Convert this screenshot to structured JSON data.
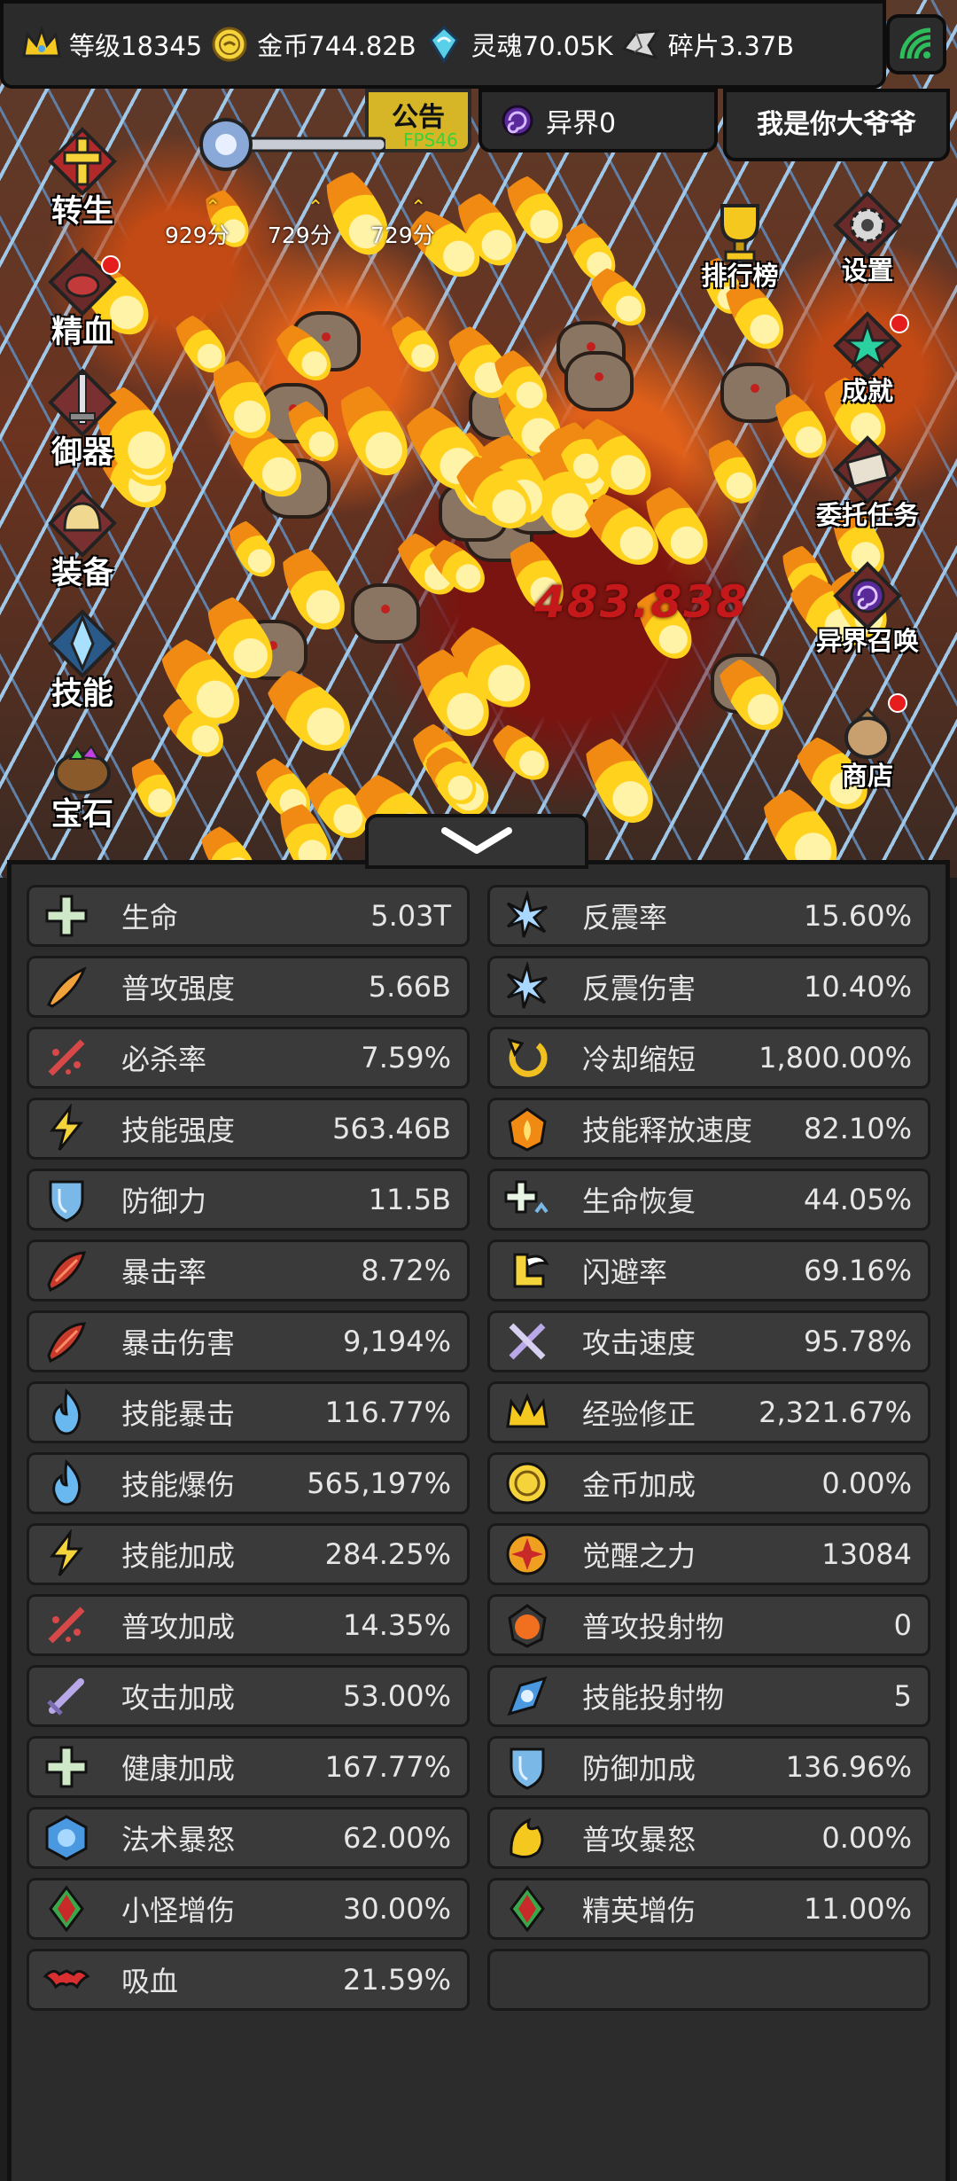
{
  "top_bar": {
    "level": "等级18345",
    "gold": "金币744.82B",
    "souls": "灵魂70.05K",
    "fragments": "碎片3.37B"
  },
  "notice_label": "公告",
  "fps_label": "FPS46",
  "otherworld_label": "异界0",
  "player_name": "我是你大爷爷",
  "scores": [
    "929分",
    "729分",
    "729分"
  ],
  "damage_number": "483.838",
  "left_menu": [
    "转生",
    "精血",
    "御器",
    "装备",
    "技能",
    "宝石"
  ],
  "right_menu": [
    "排行榜",
    "设置",
    "成就",
    "委托任务",
    "异界召唤",
    "商店"
  ],
  "stats": [
    {
      "name": "生命",
      "value": "5.03T",
      "icon": "health-plus-icon",
      "color": "#cfe9c8"
    },
    {
      "name": "反震率",
      "value": "15.60%",
      "icon": "ice-shard-icon",
      "color": "#a8d8ff"
    },
    {
      "name": "普攻强度",
      "value": "5.66B",
      "icon": "feather-strike-icon",
      "color": "#f2a23a"
    },
    {
      "name": "反震伤害",
      "value": "10.40%",
      "icon": "ice-shard-icon",
      "color": "#a8d8ff"
    },
    {
      "name": "必杀率",
      "value": "7.59%",
      "icon": "slash-icon",
      "color": "#d84848"
    },
    {
      "name": "冷却缩短",
      "value": "1,800.00%",
      "icon": "cooldown-arrow-icon",
      "color": "#f0c020"
    },
    {
      "name": "技能强度",
      "value": "563.46B",
      "icon": "lightning-icon",
      "color": "#f5d33a"
    },
    {
      "name": "技能释放速度",
      "value": "82.10%",
      "icon": "flame-badge-icon",
      "color": "#f08a12"
    },
    {
      "name": "防御力",
      "value": "11.5B",
      "icon": "shield-icon",
      "color": "#7ab8e8"
    },
    {
      "name": "生命恢复",
      "value": "44.05%",
      "icon": "regen-plus-icon",
      "color": "#e8f4e4"
    },
    {
      "name": "暴击率",
      "value": "8.72%",
      "icon": "crit-claw-icon",
      "color": "#c83a2a"
    },
    {
      "name": "闪避率",
      "value": "69.16%",
      "icon": "winged-boot-icon",
      "color": "#f5d33a"
    },
    {
      "name": "暴击伤害",
      "value": "9,194%",
      "icon": "crit-claw-icon",
      "color": "#c83a2a"
    },
    {
      "name": "攻击速度",
      "value": "95.78%",
      "icon": "crossed-swords-icon",
      "color": "#b8a8e8"
    },
    {
      "name": "技能暴击",
      "value": "116.77%",
      "icon": "blue-flame-icon",
      "color": "#6ab8f0"
    },
    {
      "name": "经验修正",
      "value": "2,321.67%",
      "icon": "crown-icon",
      "color": "#f5c820"
    },
    {
      "name": "技能爆伤",
      "value": "565,197%",
      "icon": "blue-flame-icon",
      "color": "#6ab8f0"
    },
    {
      "name": "金币加成",
      "value": "0.00%",
      "icon": "coin-icon",
      "color": "#f5d33a"
    },
    {
      "name": "技能加成",
      "value": "284.25%",
      "icon": "lightning-icon",
      "color": "#f5d33a"
    },
    {
      "name": "觉醒之力",
      "value": "13084",
      "icon": "awaken-sun-icon",
      "color": "#f0a020"
    },
    {
      "name": "普攻加成",
      "value": "14.35%",
      "icon": "slash-icon",
      "color": "#d84848"
    },
    {
      "name": "普攻投射物",
      "value": "0",
      "icon": "fire-orb-icon",
      "color": "#f07020"
    },
    {
      "name": "攻击加成",
      "value": "53.00%",
      "icon": "sword-icon",
      "color": "#b8a8e8"
    },
    {
      "name": "技能投射物",
      "value": "5",
      "icon": "blue-orb-icon",
      "color": "#4a98e0"
    },
    {
      "name": "健康加成",
      "value": "167.77%",
      "icon": "health-plus-icon",
      "color": "#cfe9c8"
    },
    {
      "name": "防御加成",
      "value": "136.96%",
      "icon": "shield-icon",
      "color": "#7ab8e8"
    },
    {
      "name": "法术暴怒",
      "value": "62.00%",
      "icon": "spell-gem-icon",
      "color": "#4a98e0"
    },
    {
      "name": "普攻暴怒",
      "value": "0.00%",
      "icon": "gold-flame-icon",
      "color": "#f5c820"
    },
    {
      "name": "小怪增伤",
      "value": "30.00%",
      "icon": "demon-mask-icon",
      "color": "#3aa84a"
    },
    {
      "name": "精英增伤",
      "value": "11.00%",
      "icon": "demon-mask-icon",
      "color": "#3aa84a"
    },
    {
      "name": "吸血",
      "value": "21.59%",
      "icon": "bat-icon",
      "color": "#d83030"
    }
  ]
}
